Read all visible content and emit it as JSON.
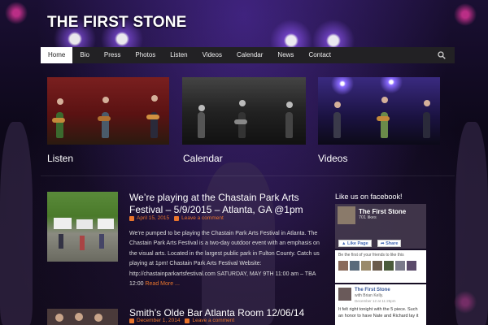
{
  "site": {
    "title": "The First Stone"
  },
  "nav": {
    "items": [
      "Home",
      "Bio",
      "Press",
      "Photos",
      "Listen",
      "Videos",
      "Calendar",
      "News",
      "Contact"
    ],
    "active": "Home",
    "search_icon": "search-icon"
  },
  "widgets": [
    {
      "label": "Listen"
    },
    {
      "label": "Calendar"
    },
    {
      "label": "Videos"
    }
  ],
  "posts": [
    {
      "title": "We’re playing at the Chastain Park Arts Festival – 5/9/2015 – Atlanta, GA @1pm",
      "date": "April 15, 2015",
      "comment": "Leave a comment",
      "excerpt": "We’re pumped to be playing the Chastain Park Arts Festival in Atlanta. The Chastain Park Arts Festival is a two-day outdoor event with an emphasis on the visual arts. Located in the largest public park in Fulton County. Catch us playing at 1pm! Chastain Park Arts Festival Website: http://chastainparkartsfestival.com SATURDAY, MAY 9TH 11:00 am – TBA 12:00",
      "read_more": "Read More ..."
    },
    {
      "title": "Smith’s Olde Bar Atlanta Room 12/06/14",
      "date": "December 1, 2014",
      "comment": "Leave a comment"
    }
  ],
  "facebook": {
    "heading": "Like us on facebook!",
    "page_name": "The First Stone",
    "likes": "701 likes",
    "like_button": "Like Page",
    "share_button": "Share",
    "friends_text": "Be the first of your friends to like this",
    "post": {
      "author": "The First Stone",
      "with": "with Brian Kelly.",
      "date": "December 12 at 11:25pm",
      "text": "It felt right tonight with the 5 piece. Such an honor to have Nate and Richard lay it"
    }
  },
  "colors": {
    "accent": "#e8742c",
    "navbar": "#222124",
    "nav_active_bg": "#ffffff"
  }
}
